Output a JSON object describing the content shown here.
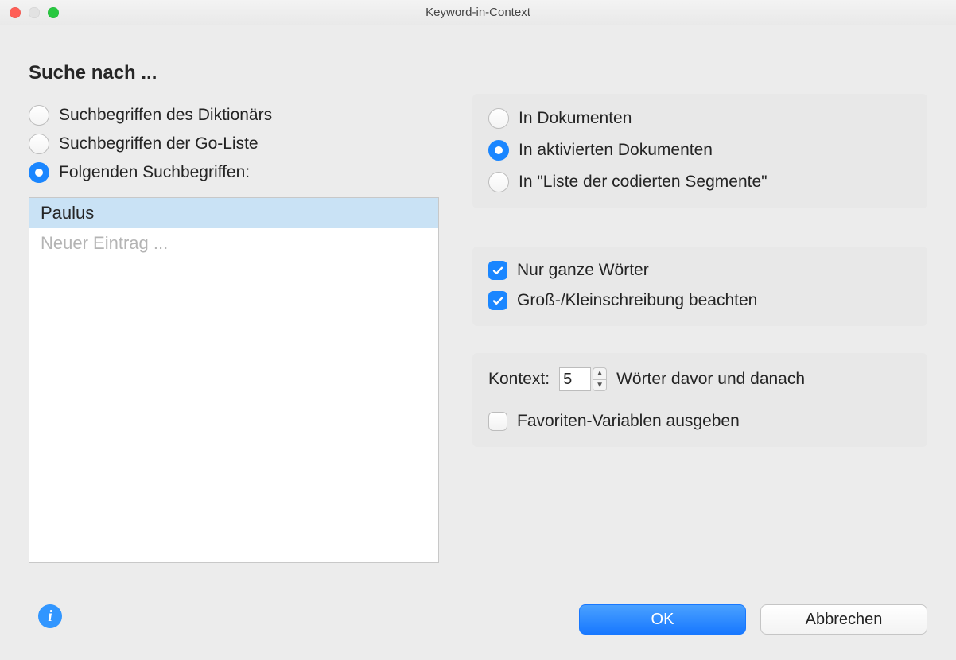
{
  "window": {
    "title": "Keyword-in-Context"
  },
  "heading": "Suche nach ...",
  "search_source": {
    "options": [
      {
        "label": "Suchbegriffen des Diktionärs",
        "checked": false
      },
      {
        "label": "Suchbegriffen der Go-Liste",
        "checked": false
      },
      {
        "label": "Folgenden Suchbegriffen:",
        "checked": true
      }
    ]
  },
  "terms_list": {
    "items": [
      "Paulus"
    ],
    "placeholder": "Neuer Eintrag ...",
    "selected_index": 0
  },
  "scope": {
    "options": [
      {
        "label": "In Dokumenten",
        "checked": false
      },
      {
        "label": "In aktivierten Dokumenten",
        "checked": true
      },
      {
        "label": "In \"Liste der codierten Segmente\"",
        "checked": false
      }
    ]
  },
  "options": {
    "whole_words": {
      "label": "Nur ganze Wörter",
      "checked": true
    },
    "case_sensitive": {
      "label": "Groß-/Kleinschreibung beachten",
      "checked": true
    }
  },
  "context": {
    "label": "Kontext:",
    "value": "5",
    "suffix": "Wörter davor und danach",
    "output_favorites": {
      "label": "Favoriten-Variablen ausgeben",
      "checked": false
    }
  },
  "buttons": {
    "ok": "OK",
    "cancel": "Abbrechen"
  }
}
